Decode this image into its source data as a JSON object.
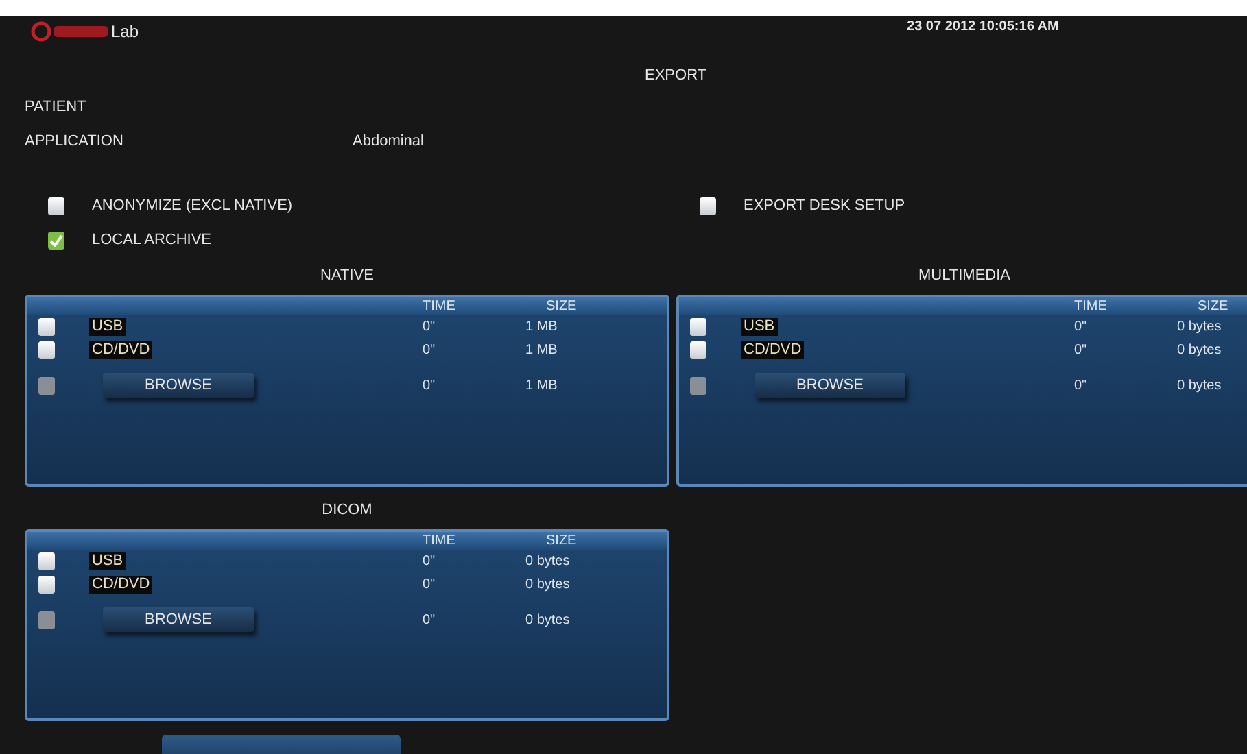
{
  "header": {
    "brand": "Lab",
    "datetime": "23 07 2012 10:05:16 AM",
    "title": "EXPORT"
  },
  "fields": [
    {
      "label": "PATIENT"
    },
    {
      "label": "APPLICATION",
      "value": "Abdominal"
    }
  ],
  "options_left": [
    {
      "label": "ANONYMIZE (EXCL NATIVE)",
      "checked": false
    },
    {
      "label": "LOCAL ARCHIVE",
      "checked": true
    }
  ],
  "options_right": [
    {
      "label": "EXPORT DESK SETUP",
      "checked": false
    }
  ],
  "panels": [
    {
      "title": "NATIVE",
      "column_time": "TIME",
      "column_size": "SIZE",
      "rows": [
        {
          "kind": "device",
          "label": "USB",
          "checked": false,
          "disabled": false,
          "time": "0\"",
          "size": "1 MB"
        },
        {
          "kind": "device",
          "label": "CD/DVD",
          "checked": false,
          "disabled": false,
          "time": "0\"",
          "size": "1 MB"
        },
        {
          "kind": "browse",
          "label": "BROWSE",
          "checked": false,
          "disabled": true,
          "time": "0\"",
          "size": "1 MB"
        }
      ]
    },
    {
      "title": "MULTIMEDIA",
      "column_time": "TIME",
      "column_size": "SIZE",
      "rows": [
        {
          "kind": "device",
          "label": "USB",
          "checked": false,
          "disabled": false,
          "time": "0\"",
          "size": "0 bytes"
        },
        {
          "kind": "device",
          "label": "CD/DVD",
          "checked": false,
          "disabled": false,
          "time": "0\"",
          "size": "0 bytes"
        },
        {
          "kind": "browse",
          "label": "BROWSE",
          "checked": false,
          "disabled": true,
          "time": "0\"",
          "size": "0 bytes"
        }
      ]
    },
    {
      "title": "DICOM",
      "column_time": "TIME",
      "column_size": "SIZE",
      "rows": [
        {
          "kind": "device",
          "label": "USB",
          "checked": false,
          "disabled": false,
          "time": "0\"",
          "size": "0 bytes"
        },
        {
          "kind": "device",
          "label": "CD/DVD",
          "checked": false,
          "disabled": false,
          "time": "0\"",
          "size": "0 bytes"
        },
        {
          "kind": "browse",
          "label": "BROWSE",
          "checked": false,
          "disabled": true,
          "time": "0\"",
          "size": "0 bytes"
        }
      ]
    }
  ]
}
